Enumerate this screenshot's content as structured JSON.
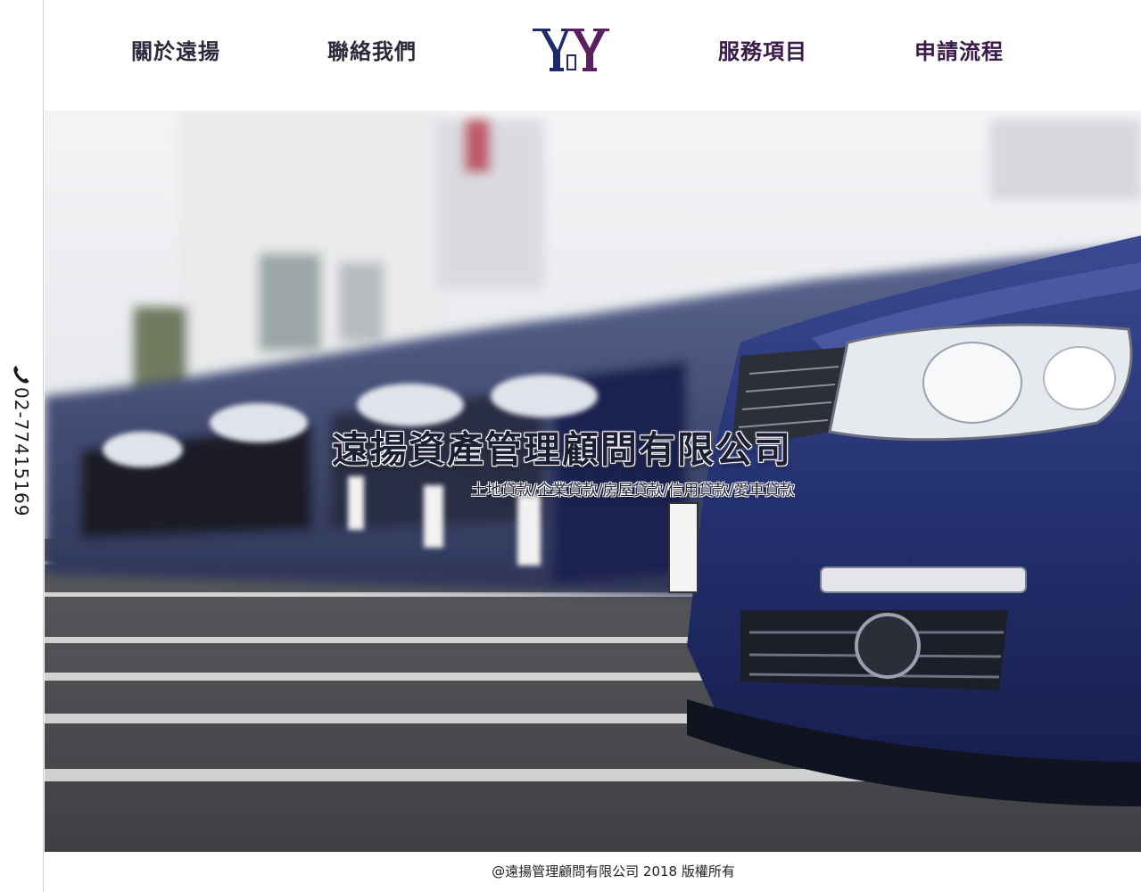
{
  "sidebar": {
    "phone_icon": "phone-icon",
    "phone_number": "02-77415169"
  },
  "header": {
    "nav": [
      {
        "label": "關於遠揚"
      },
      {
        "label": "聯絡我們"
      },
      {
        "label": "服務項目"
      },
      {
        "label": "申請流程"
      }
    ],
    "logo_text": "YY"
  },
  "hero": {
    "title": "遠揚資產管理顧問有限公司",
    "subtitle": "土地貸款/企業貸款/房屋貸款/信用貸款/愛車貸款"
  },
  "footer": {
    "copyright": "@遠揚管理顧問有限公司 2018  版權所有"
  },
  "colors": {
    "brand_navy": "#1f2a6b",
    "brand_purple": "#5a1f5f",
    "car_blue": "#23306e"
  }
}
